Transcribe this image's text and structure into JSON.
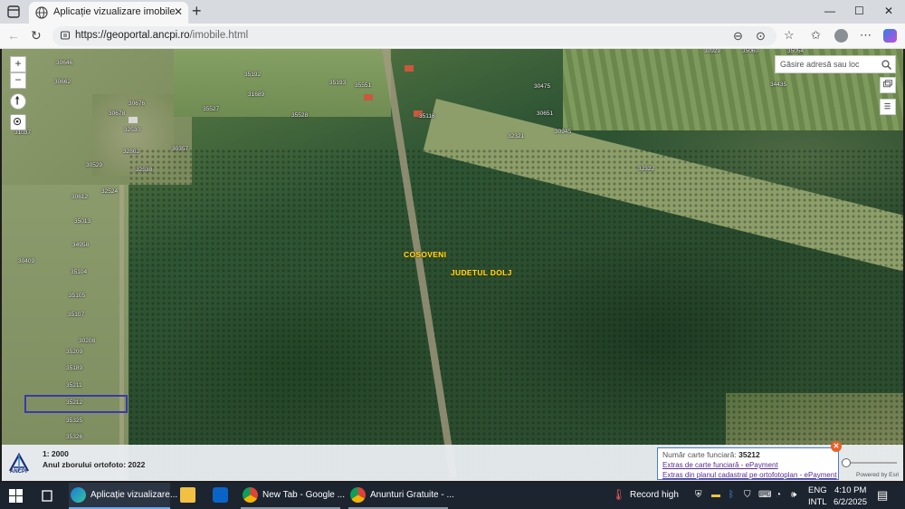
{
  "browser": {
    "tab_title": "Aplicație vizualizare imobile",
    "tab_close": "✕",
    "new_tab": "+",
    "url_host": "https://geoportal.ancpi.ro",
    "url_path": "/imobile.html"
  },
  "window_controls": {
    "minimize": "—",
    "maximize": "☐",
    "close": "✕"
  },
  "map": {
    "zoom_in": "+",
    "zoom_out": "−",
    "search_placeholder": "Găsire adresă sau loc",
    "place_labels": [
      "COSOVENI",
      "JUDETUL DOLJ"
    ],
    "parcels": [
      "30646",
      "30662",
      "31037",
      "35192",
      "35193",
      "35551",
      "30475",
      "35060",
      "34435",
      "30676",
      "30678",
      "35527",
      "35528",
      "31689",
      "35116",
      "30651",
      "30945",
      "32321",
      "32322",
      "32530",
      "30357",
      "32802",
      "30529",
      "32538",
      "32524",
      "30612",
      "35013",
      "34958",
      "30409",
      "35104",
      "35105",
      "35107",
      "30208",
      "35209",
      "35189",
      "35211",
      "35212",
      "35325",
      "35326",
      "30929",
      "35054"
    ]
  },
  "info": {
    "scale": "1: 2000",
    "ortho_year": "Anul zborului ortofoto: 2022",
    "logo_text": "ANCPI",
    "popup": {
      "label": "Număr carte funciară:",
      "number": "35212",
      "link1": "Extras de carte funciară - ePayment",
      "link2": "Extras din planul cadastral pe ortofotoplan - ePayment"
    },
    "powered": "Powered by Esri"
  },
  "taskbar": {
    "items": [
      {
        "label": "Aplicație vizualizare...",
        "color": "#1a7ad8"
      },
      {
        "label": "New Tab - Google ...",
        "color": "#34a853"
      },
      {
        "label": "Anunturi Gratuite - ...",
        "color": "#34a853"
      }
    ],
    "record": "Record high",
    "lang1": "ENG",
    "lang2": "INTL",
    "time": "4:10 PM",
    "date": "6/2/2025"
  }
}
